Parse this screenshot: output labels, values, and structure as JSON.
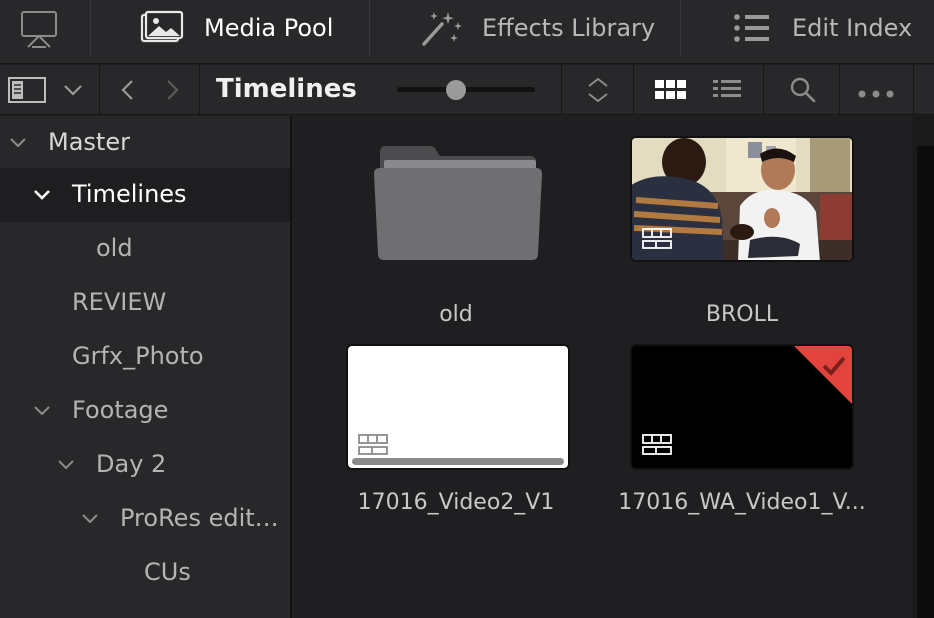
{
  "topbar": {
    "tabs": [
      {
        "label": "Media Pool",
        "icon": "media-pool-icon",
        "active": true
      },
      {
        "label": "Effects Library",
        "icon": "magic-wand-icon",
        "active": false
      },
      {
        "label": "Edit Index",
        "icon": "list-icon",
        "active": false
      }
    ]
  },
  "toolbar": {
    "bin_title": "Timelines",
    "thumb_size_level": 0.43
  },
  "sidebar": {
    "items": [
      {
        "label": "Master",
        "expanded": true
      },
      {
        "label": "Timelines",
        "expanded": true,
        "selected": true
      },
      {
        "label": "old"
      },
      {
        "label": "REVIEW"
      },
      {
        "label": "Grfx_Photo"
      },
      {
        "label": "Footage",
        "expanded": true
      },
      {
        "label": "Day 2",
        "expanded": true
      },
      {
        "label": "ProRes edit…",
        "expanded": true
      },
      {
        "label": "CUs"
      }
    ]
  },
  "clips": [
    {
      "caption": "old",
      "type": "folder"
    },
    {
      "caption": "BROLL",
      "type": "timeline-video"
    },
    {
      "caption": "17016_Video2_V1",
      "type": "timeline-blank"
    },
    {
      "caption": "17016_WA_Video1_V...",
      "type": "timeline-black",
      "flagged": true
    }
  ],
  "colors": {
    "panel": "#28282a",
    "content": "#1f1f21",
    "flag": "#e2433d"
  }
}
